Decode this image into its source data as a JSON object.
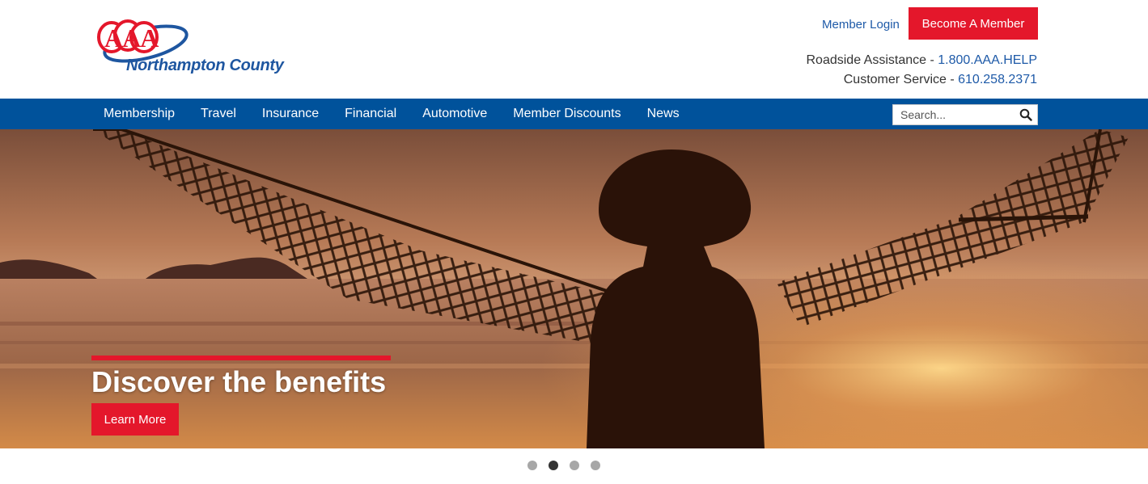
{
  "header": {
    "logo_text": "AAA",
    "logo_subtitle": "Northampton County",
    "member_login": "Member Login",
    "become_member": "Become A Member",
    "roadside_label": "Roadside Assistance - ",
    "roadside_phone": "1.800.AAA.HELP",
    "service_label": "Customer Service - ",
    "service_phone": "610.258.2371"
  },
  "nav": {
    "items": [
      "Membership",
      "Travel",
      "Insurance",
      "Financial",
      "Automotive",
      "Member Discounts",
      "News"
    ],
    "search_placeholder": "Search..."
  },
  "hero": {
    "title": "Discover the benefits",
    "cta": "Learn More"
  },
  "carousel": {
    "slide_count": 4,
    "active_slide": 2
  },
  "colors": {
    "brand_red": "#e4172b",
    "nav_blue": "#00529b",
    "link_blue": "#1e5aa8"
  },
  "icons": {
    "search": "search-icon",
    "logo": "aaa-logo-icon"
  }
}
